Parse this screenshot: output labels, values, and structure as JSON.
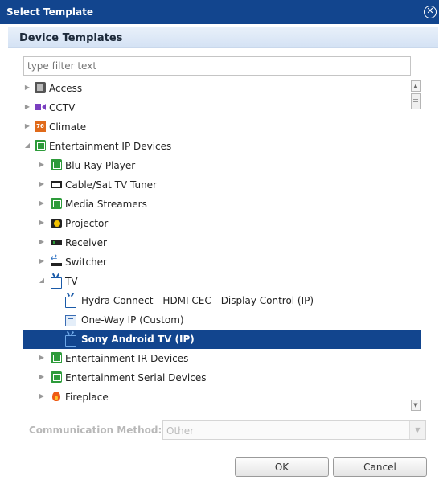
{
  "window": {
    "title": "Select Template",
    "close_label": "✕"
  },
  "section": {
    "title": "Device Templates"
  },
  "filter": {
    "placeholder": "type filter text",
    "value": ""
  },
  "tree": {
    "items": [
      {
        "label": "Access",
        "icon": "lock-icon",
        "expanded": false
      },
      {
        "label": "CCTV",
        "icon": "camera-icon",
        "expanded": false
      },
      {
        "label": "Climate",
        "icon": "thermostat-icon",
        "icon_text": "76",
        "expanded": false
      },
      {
        "label": "Entertainment IP Devices",
        "icon": "device-icon",
        "expanded": true
      },
      {
        "label": "Blu-Ray Player",
        "icon": "device-icon",
        "expanded": false
      },
      {
        "label": "Cable/Sat TV Tuner",
        "icon": "tuner-icon",
        "expanded": false
      },
      {
        "label": "Media Streamers",
        "icon": "device-icon",
        "expanded": false
      },
      {
        "label": "Projector",
        "icon": "projector-icon",
        "expanded": false
      },
      {
        "label": "Receiver",
        "icon": "receiver-icon",
        "expanded": false
      },
      {
        "label": "Switcher",
        "icon": "switcher-icon",
        "expanded": false
      },
      {
        "label": "TV",
        "icon": "tv-icon",
        "expanded": true
      },
      {
        "label": "Hydra Connect - HDMI CEC - Display Control (IP)",
        "icon": "tv-icon"
      },
      {
        "label": "One-Way IP (Custom)",
        "icon": "oneway-icon"
      },
      {
        "label": "Sony Android TV (IP)",
        "icon": "tv-icon",
        "selected": true
      },
      {
        "label": "Entertainment IR Devices",
        "icon": "device-icon",
        "expanded": false
      },
      {
        "label": "Entertainment Serial Devices",
        "icon": "device-icon",
        "expanded": false
      },
      {
        "label": "Fireplace",
        "icon": "fire-icon",
        "expanded": false
      }
    ]
  },
  "communication": {
    "label": "Communication Method:",
    "value": "Other"
  },
  "buttons": {
    "ok": "OK",
    "cancel": "Cancel"
  },
  "colors": {
    "titlebar": "#12458e",
    "selection": "#12458e",
    "device_icon_green": "#2d9b3a"
  }
}
